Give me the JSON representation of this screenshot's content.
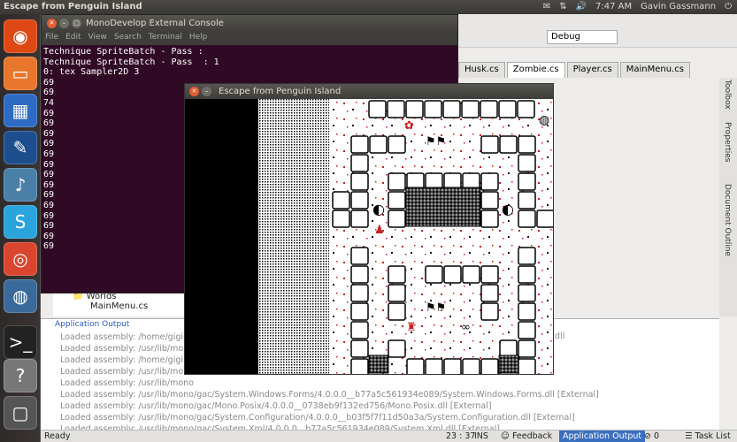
{
  "topbar": {
    "title": "Escape from Penguin Island",
    "time": "7:47 AM",
    "user": "Gavin Gassmann"
  },
  "console": {
    "title": "MonoDevelop External Console",
    "menu": [
      "File",
      "Edit",
      "View",
      "Search",
      "Terminal",
      "Help"
    ],
    "lines": "Technique SpriteBatch - Pass :\nTechnique SpriteBatch - Pass  : 1\n0: tex Sampler2D 3\n69\n69\n74\n69\n69\n69\n69\n69\n69\n69\n69\n69\n69\n69\n69\n69\n69"
  },
  "game": {
    "title": "Escape from Penguin Island"
  },
  "ide": {
    "config": "Debug",
    "tabs": [
      "Husk.cs",
      "Zombie.cs",
      "Player.cs",
      "MainMenu.cs"
    ],
    "side_labels": [
      "Toolbox",
      "Properties",
      "Document Outline"
    ],
    "tree": {
      "folder": "Worlds",
      "file": "MainMenu.cs"
    },
    "output_title": "Application Output",
    "output_lines": "Loaded assembly: /home/gigim\nLoaded assembly: /usr/lib/mono\nLoaded assembly: /home/gigim\nLoaded assembly: /usr/lib/mono\nLoaded assembly: /usr/lib/mono\nLoaded assembly: /usr/lib/mono/gac/System.Windows.Forms/4.0.0.0__b77a5c561934e089/System.Windows.Forms.dll [External]\nLoaded assembly: /usr/lib/mono/gac/Mono.Posix/4.0.0.0__0738eb9f132ed756/Mono.Posix.dll [External]\nLoaded assembly: /usr/lib/mono/gac/System.Configuration/4.0.0.0__b03f5f7f11d50a3a/System.Configuration.dll [External]\nLoaded assembly: /usr/lib/mono/gac/System.Xml/4.0.0.0__b77a5c561934e089/System.Xml.dll [External]",
    "output_right": ".dll"
  },
  "status": {
    "ready": "Ready",
    "pos": "23 : 37",
    "mode": "INS",
    "feedback": "Feedback",
    "app_output": "Application Output",
    "errors": "0",
    "tasks": "Task List"
  }
}
